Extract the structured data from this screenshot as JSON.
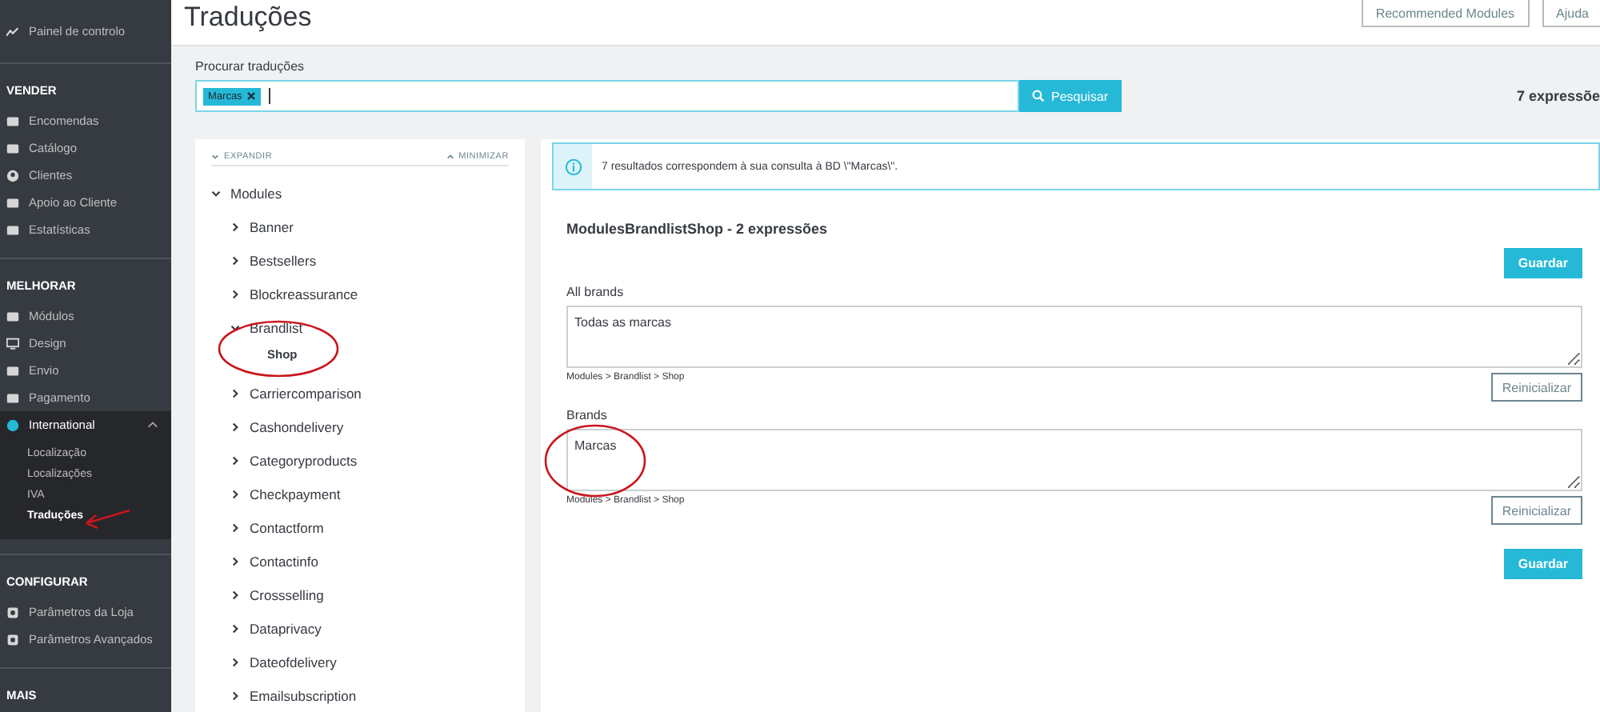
{
  "sidebar": {
    "sections": [
      {
        "items": [
          {
            "label": "Painel de controlo",
            "selected": false
          }
        ]
      },
      {
        "title": "VENDER",
        "items": [
          {
            "label": "Encomendas",
            "selected": false
          },
          {
            "label": "Catálogo",
            "selected": false
          },
          {
            "label": "Clientes",
            "selected": false
          },
          {
            "label": "Apoio ao Cliente",
            "selected": false
          },
          {
            "label": "Estatísticas",
            "selected": false
          }
        ]
      },
      {
        "title": "MELHORAR",
        "items": [
          {
            "label": "Módulos",
            "selected": false
          },
          {
            "label": "Design",
            "selected": false
          },
          {
            "label": "Envio",
            "selected": false
          },
          {
            "label": "Pagamento",
            "selected": false
          },
          {
            "label": "International",
            "selected": true,
            "expanded": true,
            "children": [
              {
                "label": "Localização",
                "selected": false
              },
              {
                "label": "Localizações",
                "selected": false
              },
              {
                "label": "IVA",
                "selected": false
              },
              {
                "label": "Traduções",
                "selected": true
              }
            ]
          }
        ]
      },
      {
        "title": "CONFIGURAR",
        "items": [
          {
            "label": "Parâmetros da Loja",
            "selected": false
          },
          {
            "label": "Parâmetros Avançados",
            "selected": false
          }
        ]
      },
      {
        "title": "MAIS"
      }
    ]
  },
  "header": {
    "title": "Traduções",
    "buttons": [
      "Recommended Modules",
      "Ajuda"
    ]
  },
  "search": {
    "label": "Procurar traduções",
    "tags": [
      "Marcas"
    ],
    "button": "Pesquisar",
    "count": "7 expressõe"
  },
  "tree": {
    "expand": "EXPANDIR",
    "collapse": "MINIMIZAR",
    "nodes": [
      {
        "label": "Modules",
        "expanded": true,
        "selected": false,
        "children": [
          {
            "label": "Banner",
            "expanded": false,
            "selected": false
          },
          {
            "label": "Bestsellers",
            "expanded": false,
            "selected": false
          },
          {
            "label": "Blockreassurance",
            "expanded": false,
            "selected": false
          },
          {
            "label": "Brandlist",
            "expanded": true,
            "selected": false,
            "children": [
              {
                "label": "Shop",
                "selected": true
              }
            ]
          },
          {
            "label": "Carriercomparison",
            "expanded": false,
            "selected": false
          },
          {
            "label": "Cashondelivery",
            "expanded": false,
            "selected": false
          },
          {
            "label": "Categoryproducts",
            "expanded": false,
            "selected": false
          },
          {
            "label": "Checkpayment",
            "expanded": false,
            "selected": false
          },
          {
            "label": "Contactform",
            "expanded": false,
            "selected": false
          },
          {
            "label": "Contactinfo",
            "expanded": false,
            "selected": false
          },
          {
            "label": "Crossselling",
            "expanded": false,
            "selected": false
          },
          {
            "label": "Dataprivacy",
            "expanded": false,
            "selected": false
          },
          {
            "label": "Dateofdelivery",
            "expanded": false,
            "selected": false
          },
          {
            "label": "Emailsubscription",
            "expanded": false,
            "selected": false
          }
        ]
      }
    ]
  },
  "results": {
    "alert": "7 resultados correspondem à sua consulta à BD \\\"Marcas\\\".",
    "heading": "ModulesBrandlistShop - 2 expressões",
    "save": "Guardar",
    "entries": [
      {
        "label": "All brands",
        "value": "Todas as marcas",
        "path": "Modules > Brandlist > Shop",
        "reset": "Reinicializar"
      },
      {
        "label": "Brands",
        "value": "Marcas",
        "path": "Modules > Brandlist > Shop",
        "reset": "Reinicializar"
      }
    ],
    "save_bottom": "Guardar"
  }
}
